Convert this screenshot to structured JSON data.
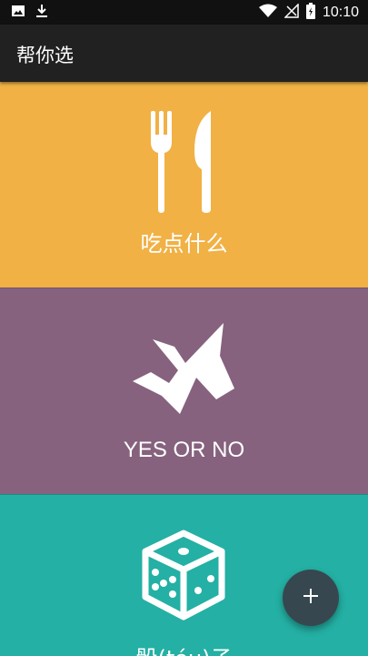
{
  "status_bar": {
    "time": "10:10",
    "icons": [
      "image-icon",
      "download-icon",
      "wifi-icon",
      "signal-icon",
      "battery-icon"
    ]
  },
  "app_bar": {
    "title": "帮你选"
  },
  "cards": [
    {
      "label": "吃点什么",
      "icon": "fork-knife-icon",
      "color": "#F1B145"
    },
    {
      "label": "YES OR NO",
      "icon": "yes-no-icon",
      "color": "#86627E"
    },
    {
      "label": "骰(tóu)子",
      "icon": "dice-icon",
      "color": "#24B0A4"
    }
  ],
  "fab": {
    "icon": "plus-icon",
    "color": "#37474F"
  }
}
